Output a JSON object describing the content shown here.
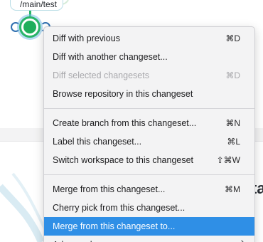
{
  "graph": {
    "branch_label": "/main/test",
    "colors": {
      "branch_green": "#2ab56a",
      "node_ring_blue": "#2f6fb0",
      "highlight": "#2f8fe6"
    }
  },
  "background": {
    "heading_fragment": "ta"
  },
  "context_menu": {
    "groups": [
      {
        "items": [
          {
            "label": "Diff with previous",
            "shortcut": "⌘D",
            "state": "normal"
          },
          {
            "label": "Diff with another changeset...",
            "shortcut": "",
            "state": "normal"
          },
          {
            "label": "Diff selected changesets",
            "shortcut": "⌘D",
            "state": "disabled"
          },
          {
            "label": "Browse repository in this changeset",
            "shortcut": "",
            "state": "normal"
          }
        ]
      },
      {
        "items": [
          {
            "label": "Create branch from this changeset...",
            "shortcut": "⌘N",
            "state": "normal"
          },
          {
            "label": "Label this changeset...",
            "shortcut": "⌘L",
            "state": "normal"
          },
          {
            "label": "Switch workspace to this changeset",
            "shortcut": "⇧⌘W",
            "state": "normal"
          }
        ]
      },
      {
        "items": [
          {
            "label": "Merge from this changeset...",
            "shortcut": "⌘M",
            "state": "normal"
          },
          {
            "label": "Cherry pick from this changeset...",
            "shortcut": "",
            "state": "normal"
          },
          {
            "label": "Merge from this changeset to...",
            "shortcut": "",
            "state": "selected"
          },
          {
            "label": "Advanced merge",
            "shortcut": "",
            "state": "normal",
            "submenu": true,
            "submenu_icon": "chevron-right-icon"
          }
        ]
      }
    ]
  }
}
